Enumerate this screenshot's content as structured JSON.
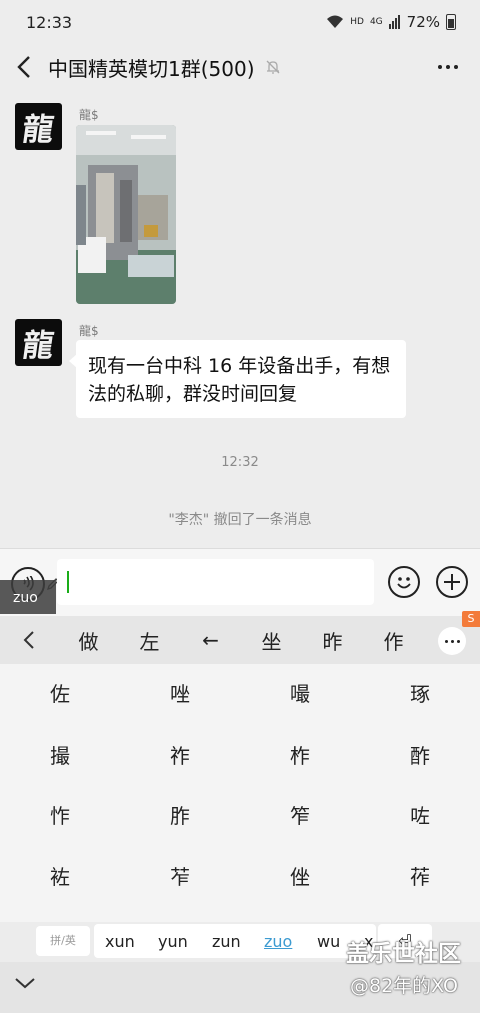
{
  "status": {
    "time": "12:33",
    "hd": "HD",
    "net": "4G",
    "battery": "72%"
  },
  "chat": {
    "title": "中国精英模切1群(500)"
  },
  "messages": [
    {
      "sender": "龍$",
      "avatar_char": "龍",
      "type": "image"
    },
    {
      "sender": "龍$",
      "avatar_char": "龍",
      "type": "text",
      "lines": [
        "现有一台中科 16 年设备出手，有想",
        "法的私聊，群没时间回复"
      ]
    }
  ],
  "timestamp": "12:32",
  "recall_notice": "\"李杰\" 撤回了一条消息",
  "input": {
    "value": "",
    "composing_badge": "zuo"
  },
  "candidates": [
    "做",
    "左",
    "←",
    "坐",
    "昨",
    "作"
  ],
  "grid": [
    [
      "佐",
      "唑",
      "嘬",
      "琢"
    ],
    [
      "撮",
      "祚",
      "柞",
      "酢"
    ],
    [
      "怍",
      "胙",
      "笮",
      "咗"
    ],
    [
      "袏",
      "苲",
      "侳",
      "莋"
    ]
  ],
  "pinyin": {
    "switch_label": "拼/英",
    "options": [
      "xun",
      "yun",
      "zun",
      "zuo",
      "wu",
      "x"
    ],
    "active": "zuo",
    "enter_label": "⏎"
  },
  "watermark": {
    "line1": "盖乐世社区",
    "line2": "@82年的XO"
  },
  "sogou": "S"
}
